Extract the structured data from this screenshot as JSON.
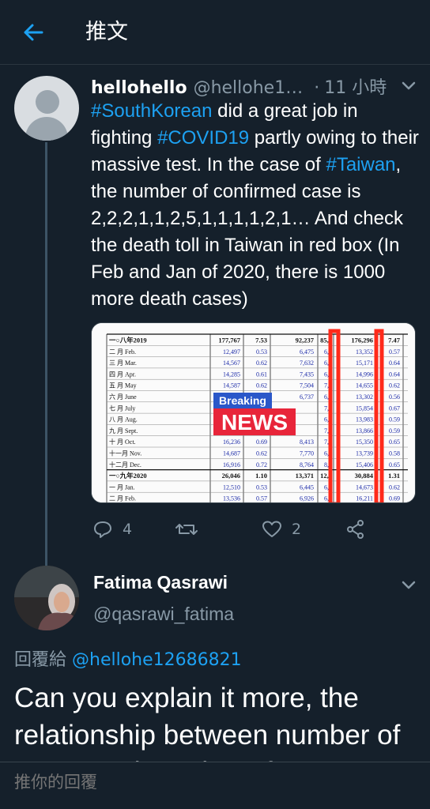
{
  "header": {
    "title": "推文"
  },
  "tweet": {
    "name": "hellohello",
    "handle": "@hellohe1…",
    "dot": "·",
    "time": "11 小時",
    "text_parts": {
      "t1": "#SouthKorean",
      "t2": " did a great job in fighting ",
      "t3": "#COVID19",
      "t4": " partly owing to their massive test.  In the case of ",
      "t5": "#Taiwan",
      "t6": ", the number of confirmed case is 2,2,2,1,1,2,5,1,1,1,1,2,1… And check the death toll in Taiwan in red box (In Feb and Jan of 2020, there is 1000 more death cases)"
    },
    "media": {
      "overlay_top": "Breaking",
      "overlay_bottom": "NEWS",
      "rows": [
        {
          "label": "一○八年2019",
          "c1": "177,767",
          "c2": "7.53",
          "c3": "92,237",
          "c4": "85,5",
          "c5": "176,296",
          "c6": "7.47"
        },
        {
          "label": "二  月 Feb.",
          "c1": "12,497",
          "c2": "0.53",
          "c3": "6,475",
          "c4": "6,0",
          "c5": "13,352",
          "c6": "0.57"
        },
        {
          "label": "三  月 Mar.",
          "c1": "14,567",
          "c2": "0.62",
          "c3": "7,632",
          "c4": "6,9",
          "c5": "15,171",
          "c6": "0.64"
        },
        {
          "label": "四  月 Apr.",
          "c1": "14,285",
          "c2": "0.61",
          "c3": "7,435",
          "c4": "6,8",
          "c5": "14,996",
          "c6": "0.64"
        },
        {
          "label": "五  月 May",
          "c1": "14,587",
          "c2": "0.62",
          "c3": "7,504",
          "c4": "7,0",
          "c5": "14,655",
          "c6": "0.62"
        },
        {
          "label": "六  月 June",
          "c1": "",
          "c2": "",
          "c3": "6,737",
          "c4": "6,1",
          "c5": "13,302",
          "c6": "0.56"
        },
        {
          "label": "七  月 July",
          "c1": "",
          "c2": "",
          "c3": "",
          "c4": "7,3",
          "c5": "15,854",
          "c6": "0.67"
        },
        {
          "label": "八  月 Aug.",
          "c1": "",
          "c2": "",
          "c3": "",
          "c4": "6,9",
          "c5": "13,983",
          "c6": "0.59"
        },
        {
          "label": "九  月 Sept.",
          "c1": "",
          "c2": "",
          "c3": "",
          "c4": "7,0",
          "c5": "13,866",
          "c6": "0.59"
        },
        {
          "label": "十  月 Oct.",
          "c1": "16,236",
          "c2": "0.69",
          "c3": "8,413",
          "c4": "7,8",
          "c5": "15,350",
          "c6": "0.65"
        },
        {
          "label": "十一月 Nov.",
          "c1": "14,687",
          "c2": "0.62",
          "c3": "7,770",
          "c4": "6,9",
          "c5": "13,739",
          "c6": "0.58"
        },
        {
          "label": "十二月 Dec.",
          "c1": "16,916",
          "c2": "0.72",
          "c3": "8,764",
          "c4": "8,1",
          "c5": "15,406",
          "c6": "0.65"
        },
        {
          "label": "一○九年2020",
          "c1": "26,046",
          "c2": "1.10",
          "c3": "13,371",
          "c4": "12,6",
          "c5": "30,884",
          "c6": "1.31"
        },
        {
          "label": "一  月 Jan.",
          "c1": "12,510",
          "c2": "0.53",
          "c3": "6,445",
          "c4": "6,0",
          "c5": "14,673",
          "c6": "0.62"
        },
        {
          "label": "二  月 Feb.",
          "c1": "13,536",
          "c2": "0.57",
          "c3": "6,926",
          "c4": "6,6",
          "c5": "16,211",
          "c6": "0.69"
        }
      ]
    },
    "actions": {
      "reply_count": "4",
      "retweet_count": "",
      "like_count": "2"
    }
  },
  "reply": {
    "name": "Fatima Qasrawi",
    "handle": "@qasrawi_fatima",
    "replying_prefix": "回覆給 ",
    "replying_to": "@hellohe12686821",
    "text": "Can you explain it more, the relationship between number of cases and number of"
  },
  "composer": {
    "placeholder": "推你的回覆"
  },
  "colors": {
    "background": "#15202b",
    "accent": "#1da1f2",
    "secondary_text": "#8899a6"
  }
}
